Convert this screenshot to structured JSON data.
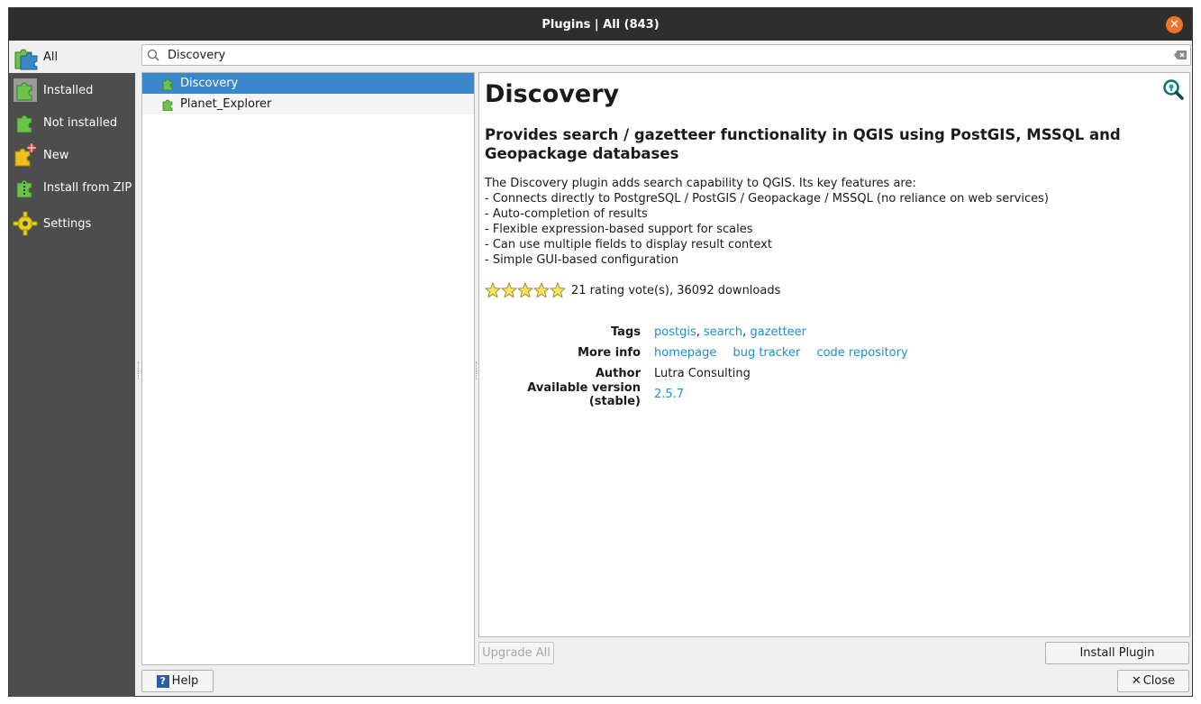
{
  "window": {
    "title": "Plugins | All (843)"
  },
  "sidebar": {
    "items": [
      {
        "label": "All",
        "icon": "puzzle-all-icon"
      },
      {
        "label": "Installed",
        "icon": "puzzle-installed-icon"
      },
      {
        "label": "Not installed",
        "icon": "puzzle-not-installed-icon"
      },
      {
        "label": "New",
        "icon": "puzzle-new-icon"
      },
      {
        "label": "Install from ZIP",
        "icon": "puzzle-zip-icon"
      },
      {
        "label": "Settings",
        "icon": "gear-icon"
      }
    ]
  },
  "search": {
    "value": "Discovery"
  },
  "plugin_list": [
    {
      "name": "Discovery",
      "selected": true
    },
    {
      "name": "Planet_Explorer",
      "selected": false
    }
  ],
  "details": {
    "title": "Discovery",
    "subtitle": "Provides search / gazetteer functionality in QGIS using PostGIS, MSSQL and Geopackage databases",
    "description_lines": [
      "The Discovery plugin adds search capability to QGIS. Its key features are:",
      "- Connects directly to PostgreSQL / PostGIS / Geopackage / MSSQL (no reliance on web services)",
      "- Auto-completion of results",
      "- Flexible expression-based support for scales",
      "- Can use multiple fields to display result context",
      "- Simple GUI-based configuration"
    ],
    "rating_stars": 5,
    "rating_text": "21 rating vote(s), 36092 downloads",
    "tags_label": "Tags",
    "tags": [
      "postgis",
      "search",
      "gazetteer"
    ],
    "tag_sep": ", ",
    "more_info_label": "More info",
    "more_info_links": [
      "homepage",
      "bug tracker",
      "code repository"
    ],
    "author_label": "Author",
    "author": "Lutra Consulting",
    "version_label": "Available version (stable)",
    "version": "2.5.7"
  },
  "buttons": {
    "upgrade_all": "Upgrade All",
    "install_plugin": "Install Plugin",
    "help": "Help",
    "close": "Close"
  },
  "colors": {
    "accent": "#3a87c9",
    "link": "#1a8fd0",
    "sidebar_bg": "#4d4d4d",
    "titlebar_bg": "#2e2e2e",
    "close_button": "#f0732a"
  }
}
